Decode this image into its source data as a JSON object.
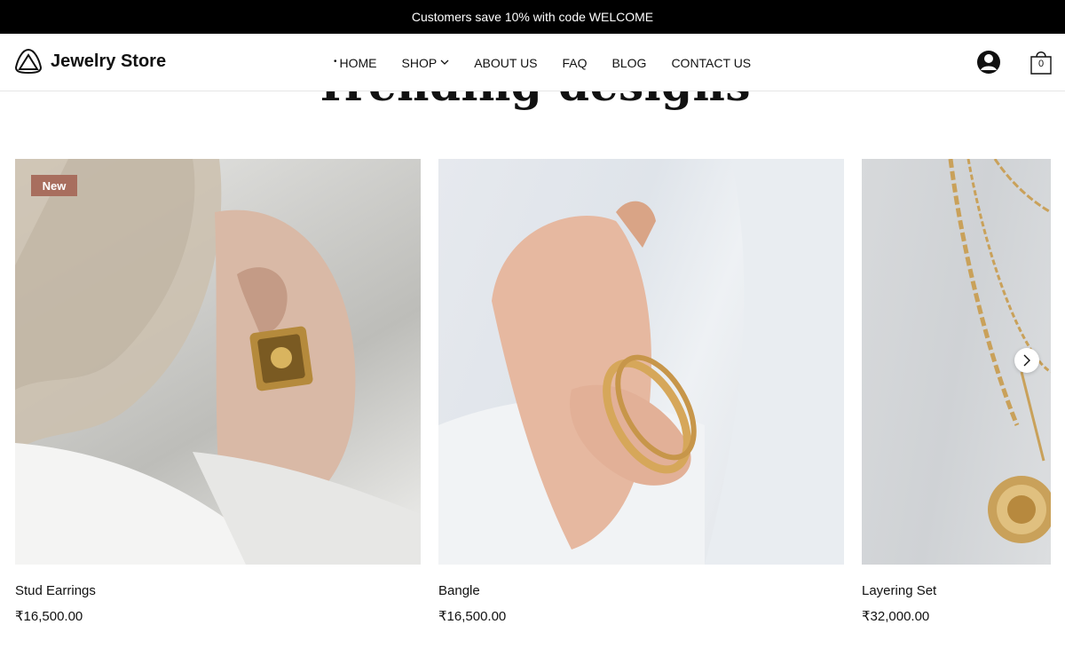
{
  "announcement": "Customers save 10% with code WELCOME",
  "brand": {
    "name": "Jewelry Store"
  },
  "nav": {
    "items": [
      {
        "label": "HOME",
        "active": true
      },
      {
        "label": "SHOP",
        "has_dropdown": true
      },
      {
        "label": "ABOUT US"
      },
      {
        "label": "FAQ"
      },
      {
        "label": "BLOG"
      },
      {
        "label": "CONTACT US"
      }
    ]
  },
  "header_icons": {
    "account": "account-icon",
    "cart": "shopping-bag-icon",
    "cart_count": "0"
  },
  "section": {
    "title": "Trending designs"
  },
  "products": [
    {
      "name": "Stud Earrings",
      "price": "₹16,500.00",
      "badge": "New"
    },
    {
      "name": "Bangle",
      "price": "₹16,500.00"
    },
    {
      "name": "Layering Set",
      "price": "₹32,000.00"
    }
  ],
  "colors": {
    "announcement_bg": "#000000",
    "badge_bg": "#a86e5e"
  }
}
